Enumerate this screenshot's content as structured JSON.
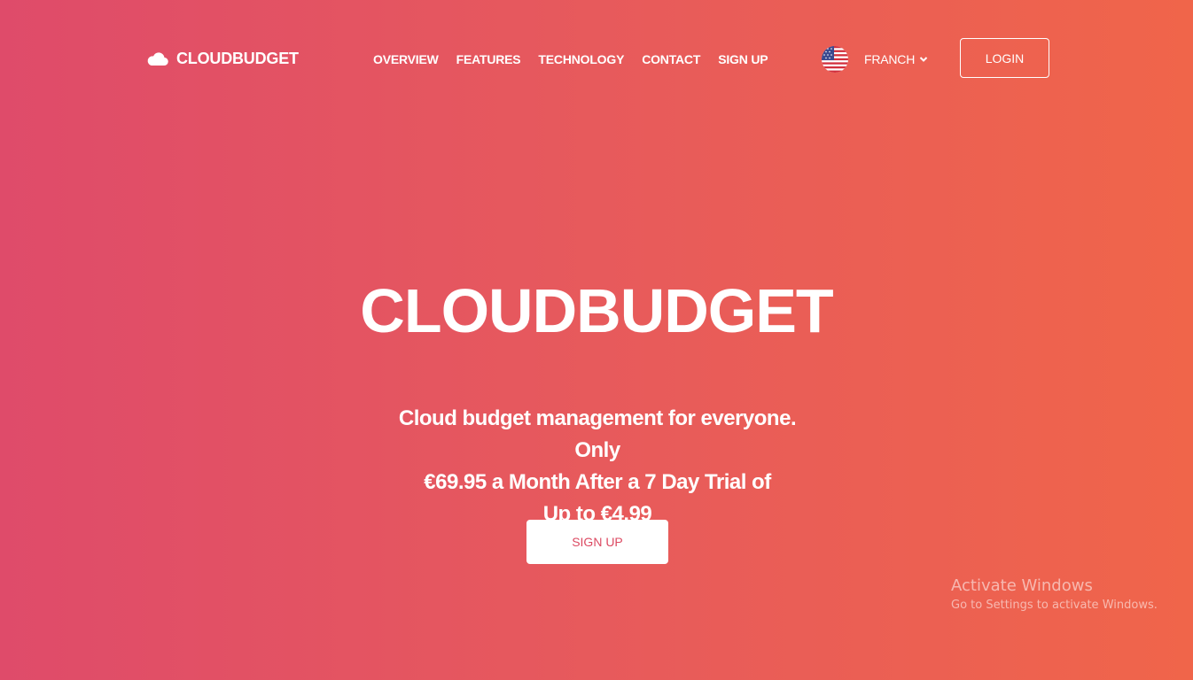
{
  "header": {
    "brand": "CLOUDBUDGET",
    "brand_icon": "cloud-icon",
    "nav": [
      {
        "label": "OVERVIEW"
      },
      {
        "label": "FEATURES"
      },
      {
        "label": "TECHNOLOGY"
      },
      {
        "label": "CONTACT"
      },
      {
        "label": "SIGN UP"
      }
    ],
    "language": {
      "flag_icon": "us-flag-icon",
      "label": "FRANCH",
      "chevron_icon": "chevron-down-icon"
    },
    "login_label": "LOGIN"
  },
  "hero": {
    "title": "CLOUDBUDGET",
    "subtitle_lines": [
      "Cloud budget management for everyone. Only",
      "€69.95 a Month After a 7 Day Trial of",
      "Up to €4.99"
    ],
    "cta_label": "SIGN UP"
  },
  "watermark": {
    "title": "Activate Windows",
    "subtitle": "Go to Settings to activate Windows."
  },
  "colors": {
    "gradient_start": "#df4b6a",
    "gradient_end": "#f0654a",
    "cta_text": "#dc4a62"
  }
}
